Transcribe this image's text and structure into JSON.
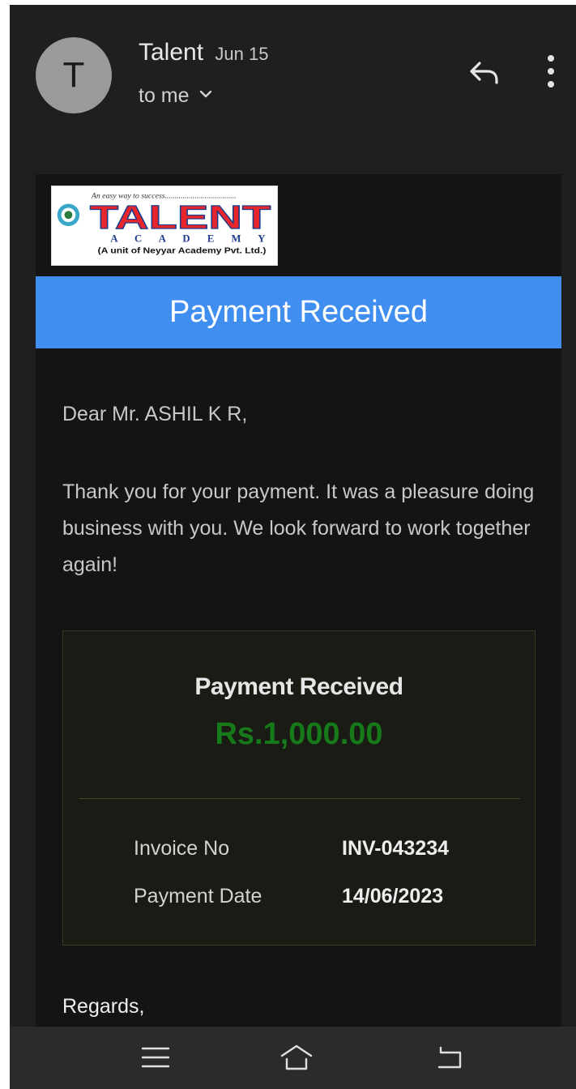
{
  "header": {
    "avatar_letter": "T",
    "sender_name": "Talent",
    "date": "Jun 15",
    "recipient": "to me",
    "icons": [
      "reply-icon",
      "more-vert-icon",
      "chevron-down-icon"
    ]
  },
  "logo": {
    "tagline": "An easy way to success....................................",
    "name": "TALENT",
    "sub": "A C A D E M Y",
    "unit": "(A unit of Neyyar Academy Pvt. Ltd.)"
  },
  "email": {
    "banner": "Payment Received",
    "greeting": "Dear Mr. ASHIL K R,",
    "message": "Thank you for your payment. It was a pleasure doing business with you. We look forward to work together again!",
    "receipt": {
      "title": "Payment Received",
      "amount": "Rs.1,000.00",
      "rows": [
        {
          "label": "Invoice No",
          "value": "INV-043234"
        },
        {
          "label": "Payment Date",
          "value": "14/06/2023"
        }
      ]
    },
    "regards": "Regards,"
  },
  "navbar": {
    "icons": [
      "menu-icon",
      "home-icon",
      "back-icon"
    ]
  },
  "colors": {
    "banner": "#3f8ef0",
    "amount": "#167a1a",
    "logo_red": "#e8252b",
    "logo_blue": "#1c3c8c"
  }
}
